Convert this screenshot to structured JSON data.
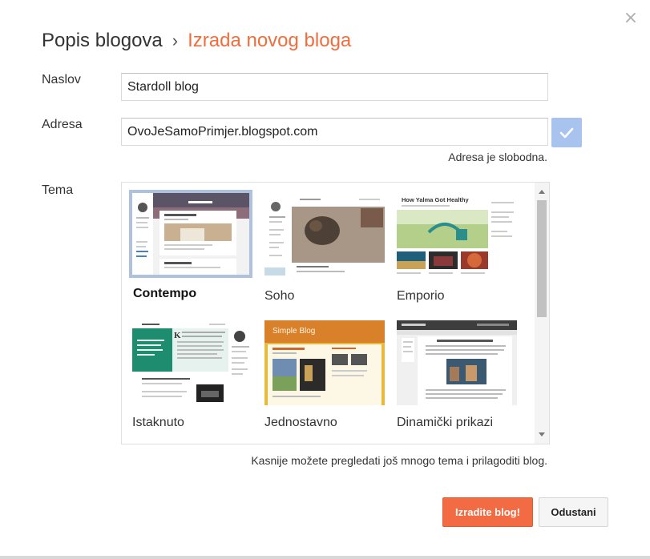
{
  "dialog": {
    "close_glyph": "×",
    "breadcrumb_parent": "Popis blogova",
    "breadcrumb_sep": "›",
    "breadcrumb_current": "Izrada novog bloga"
  },
  "form": {
    "title_label": "Naslov",
    "title_value": "Stardoll blog",
    "address_label": "Adresa",
    "address_value": "OvoJeSamoPrimjer.blogspot.com",
    "address_status": "Adresa je slobodna.",
    "theme_label": "Tema",
    "theme_hint": "Kasnije možete pregledati još mnogo tema i prilagoditi blog."
  },
  "themes": [
    {
      "name": "Contempo",
      "selected": true
    },
    {
      "name": "Soho",
      "selected": false
    },
    {
      "name": "Emporio",
      "selected": false
    },
    {
      "name": "Istaknuto",
      "selected": false
    },
    {
      "name": "Jednostavno",
      "selected": false
    },
    {
      "name": "Dinamički prikazi",
      "selected": false
    }
  ],
  "thumb_text": {
    "emporio_title": "How Yalma Got Healthy",
    "simple_title": "Simple Blog"
  },
  "buttons": {
    "create": "Izradite blog!",
    "cancel": "Odustani"
  },
  "colors": {
    "accent": "#f26d3d",
    "check_bg": "#a8c4ee",
    "selected_border": "#aec2dd"
  }
}
